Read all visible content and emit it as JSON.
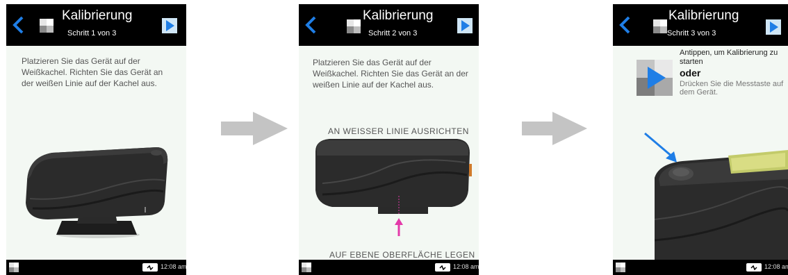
{
  "screens": [
    {
      "title": "Kalibrierung",
      "step": "Schritt 1 von 3",
      "instruction": "Platzieren Sie das Gerät auf der\nWeißkachel. Richten Sie das Gerät an\nder weißen Linie auf der Kachel aus.",
      "time": "12:08 am"
    },
    {
      "title": "Kalibrierung",
      "step": "Schritt 2 von 3",
      "instruction": "Platzieren Sie das Gerät auf der\nWeißkachel. Richten Sie das Gerät an der\nweißen Linie auf der Kachel aus.",
      "caption_top": "AN WEISSER LINIE AUSRICHTEN",
      "caption_bottom": "AUF EBENE OBERFLÄCHE LEGEN",
      "time": "12:08 am"
    },
    {
      "title": "Kalibrierung",
      "step": "Schritt 3 von 3",
      "action_line1": "Antippen, um Kalibrierung zu",
      "action_line2": "starten",
      "action_oder": "oder",
      "action_alt": "Drücken Sie die Messtaste auf\ndem Gerät.",
      "time": "12:08 am"
    }
  ],
  "colors": {
    "accent": "#1f7ee6",
    "bar": "#000000",
    "screen_bg": "#f3f8f3",
    "arrow_gray": "#c4c4c4",
    "marker_magenta": "#e33aa9"
  },
  "icons": {
    "back": "back-chevron-icon",
    "logo": "color-tiles-logo-icon",
    "play": "play-icon",
    "battery": "battery-charging-icon"
  }
}
